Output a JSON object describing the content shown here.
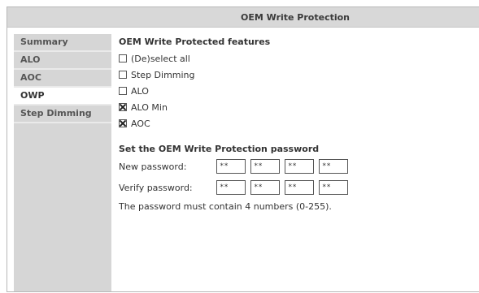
{
  "title": "OEM Write Protection",
  "sidebar": {
    "items": [
      {
        "label": "Summary"
      },
      {
        "label": "ALO"
      },
      {
        "label": "AOC"
      },
      {
        "label": "OWP"
      },
      {
        "label": "Step Dimming"
      }
    ],
    "active_index": 3
  },
  "features": {
    "heading": "OEM Write Protected features",
    "items": [
      {
        "label": "(De)select all",
        "checked": false
      },
      {
        "label": "Step Dimming",
        "checked": false
      },
      {
        "label": "ALO",
        "checked": false
      },
      {
        "label": "ALO Min",
        "checked": true
      },
      {
        "label": "AOC",
        "checked": true
      }
    ]
  },
  "password": {
    "heading": "Set the OEM Write Protection password",
    "new_label": "New password:",
    "verify_label": "Verify password:",
    "new_values": [
      "**",
      "**",
      "**",
      "**"
    ],
    "verify_values": [
      "**",
      "**",
      "**",
      "**"
    ],
    "note": "The password must contain 4 numbers (0-255)."
  }
}
